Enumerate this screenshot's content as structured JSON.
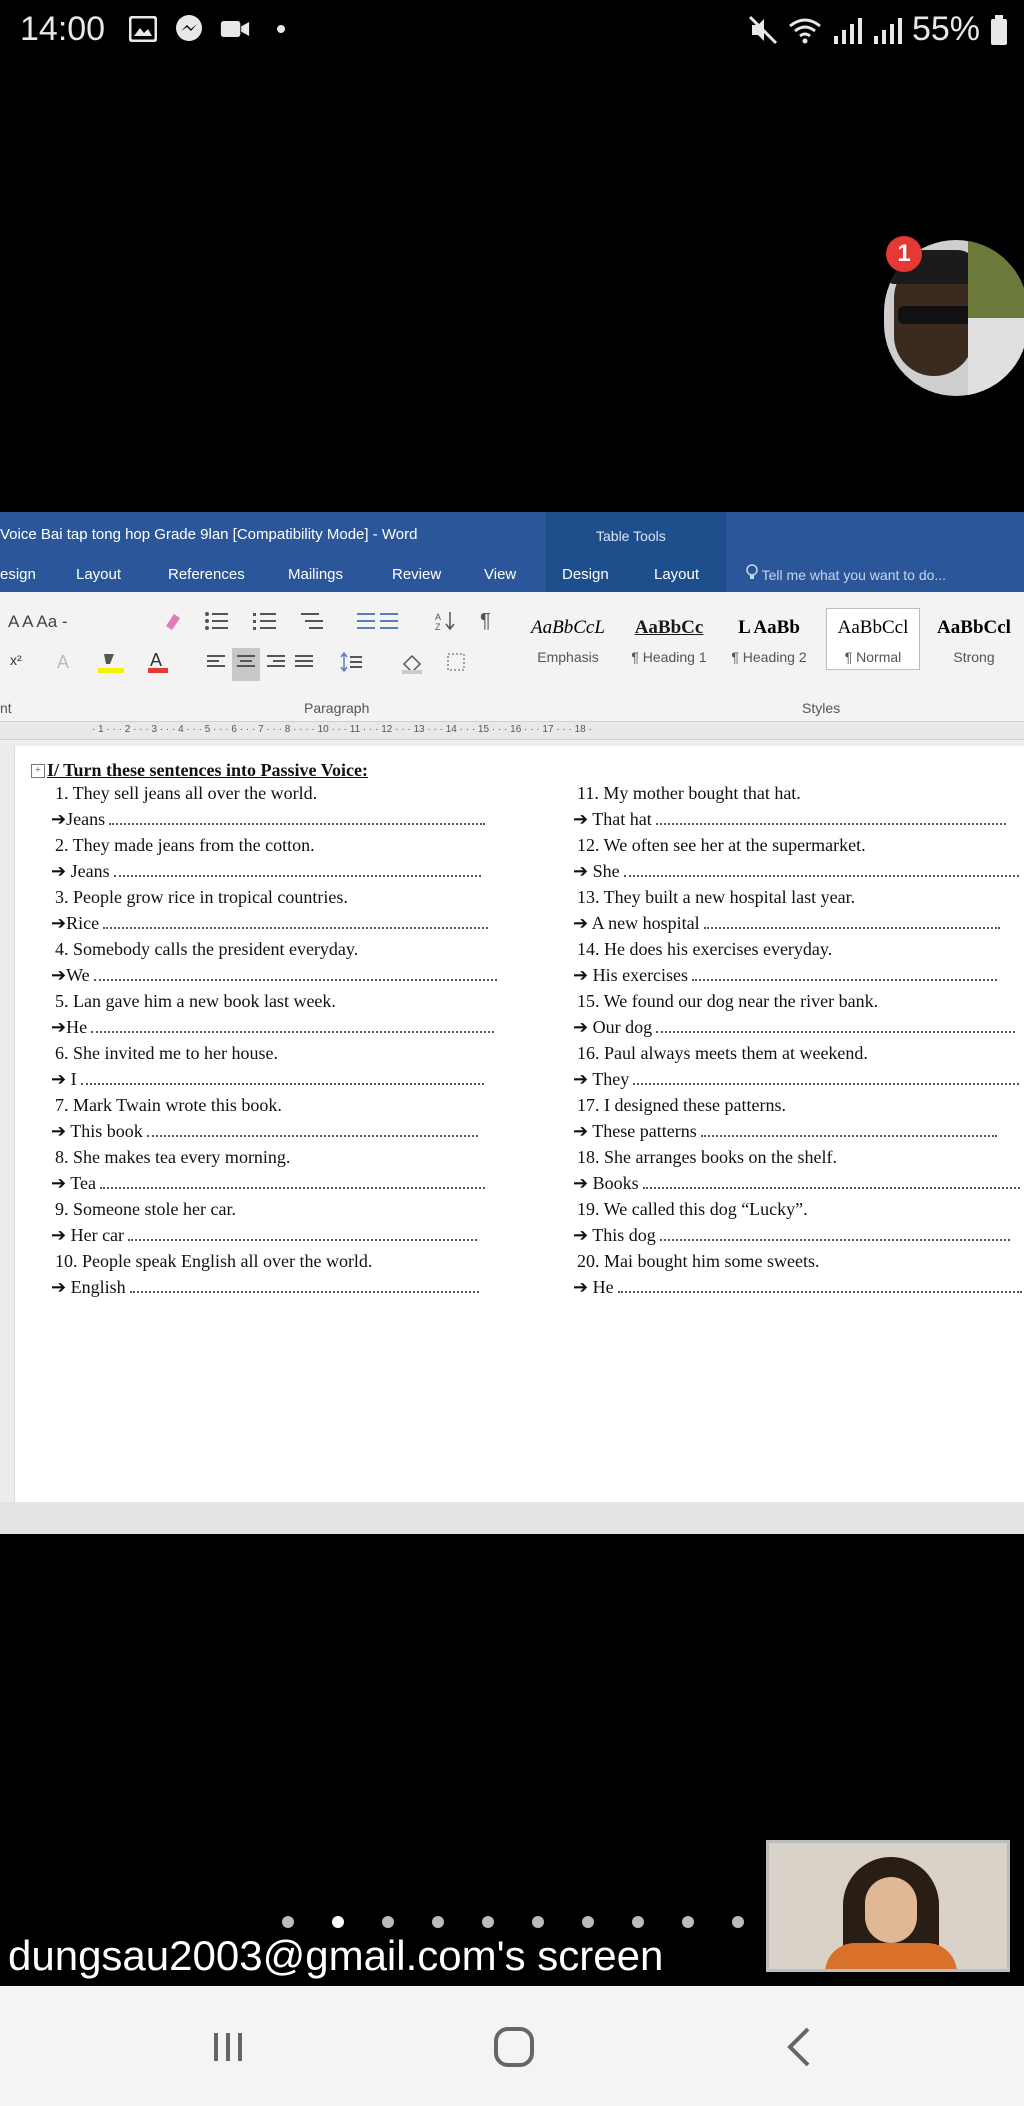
{
  "status_bar": {
    "time": "14:00",
    "battery": "55%",
    "left_icons": [
      "image-icon",
      "messenger-icon",
      "video-camera-icon",
      "dot-icon"
    ],
    "right_icons": [
      "mute-icon",
      "wifi-icon",
      "signal-icon",
      "signal-icon",
      "battery-icon"
    ]
  },
  "participant": {
    "badge_count": "1"
  },
  "word": {
    "window_title": "Voice Bai tap tong hop Grade 9lan [Compatibility Mode] - Word",
    "table_tools_label": "Table Tools",
    "tabs": [
      "esign",
      "Layout",
      "References",
      "Mailings",
      "Review",
      "View",
      "Design",
      "Layout"
    ],
    "tell_me": "Tell me what you want to do...",
    "ribbon": {
      "font_row1": "A  A   Aa -",
      "group_paragraph": "Paragraph",
      "group_font_partial": "nt",
      "group_styles": "Styles",
      "styles": [
        {
          "sample": "AaBbCcL",
          "name": "Emphasis"
        },
        {
          "sample": "AaBbCc",
          "name": "¶ Heading 1"
        },
        {
          "sample": "L  AaBb",
          "name": "¶ Heading 2"
        },
        {
          "sample": "AaBbCcl",
          "name": "¶ Normal"
        },
        {
          "sample": "AaBbCcl",
          "name": "Strong"
        }
      ]
    },
    "ruler_text": "· 1 · · · 2 · · · 3 · · · 4 · · · 5 · · · 6 · · · 7 · · · 8 · ·        · · 10 · · · 11 · · · 12 · · · 13 · · · 14 · · · 15 · · · 16 · · · 17 · · · 18 ·",
    "document": {
      "heading": "I/ Turn these sentences into Passive Voice:",
      "left_column": [
        {
          "q": "1.  They sell jeans all over the world.",
          "a": "➔Jeans"
        },
        {
          "q": "2.  They made jeans from the cotton.",
          "a": "➔ Jeans"
        },
        {
          "q": "3.  People grow rice in tropical countries.",
          "a": "➔Rice"
        },
        {
          "q": "4.  Somebody calls the president everyday.",
          "a": "➔We"
        },
        {
          "q": "5.  Lan gave him a new book last week.",
          "a": "➔He"
        },
        {
          "q": "6.  She invited me to her house.",
          "a": "➔ I"
        },
        {
          "q": "7.  Mark Twain wrote this book.",
          "a": "➔ This book"
        },
        {
          "q": "8.  She makes tea every morning.",
          "a": "➔ Tea"
        },
        {
          "q": "9.  Someone stole her car.",
          "a": "➔ Her car"
        },
        {
          "q": "10. People speak English all over the world.",
          "a": "➔ English"
        }
      ],
      "right_column": [
        {
          "q": "11. My mother bought that hat.",
          "a": "➔ That hat"
        },
        {
          "q": "12. We often see her at the supermarket.",
          "a": "➔ She"
        },
        {
          "q": "13. They built a new hospital last year.",
          "a": "➔ A new hospital"
        },
        {
          "q": "14. He does his exercises everyday.",
          "a": "➔ His exercises"
        },
        {
          "q": "15. We found our dog near the river bank.",
          "a": "➔ Our dog"
        },
        {
          "q": "16. Paul always meets them at weekend.",
          "a": "➔ They"
        },
        {
          "q": "17. I designed these patterns.",
          "a": "➔ These patterns"
        },
        {
          "q": "18. She arranges books on the shelf.",
          "a": "➔ Books"
        },
        {
          "q": "19. We called this dog “Lucky”.",
          "a": "➔ This dog"
        },
        {
          "q": "20. Mai bought him some sweets.",
          "a": "➔ He"
        }
      ]
    }
  },
  "screen_share_label": "dungsau2003@gmail.com's screen",
  "page_indicator": {
    "count": 10,
    "active": 1
  },
  "nav_bar": {
    "buttons": [
      "recent-apps-icon",
      "home-icon",
      "back-icon"
    ]
  },
  "colors": {
    "word_blue": "#2b579a",
    "badge_red": "#e53935"
  }
}
